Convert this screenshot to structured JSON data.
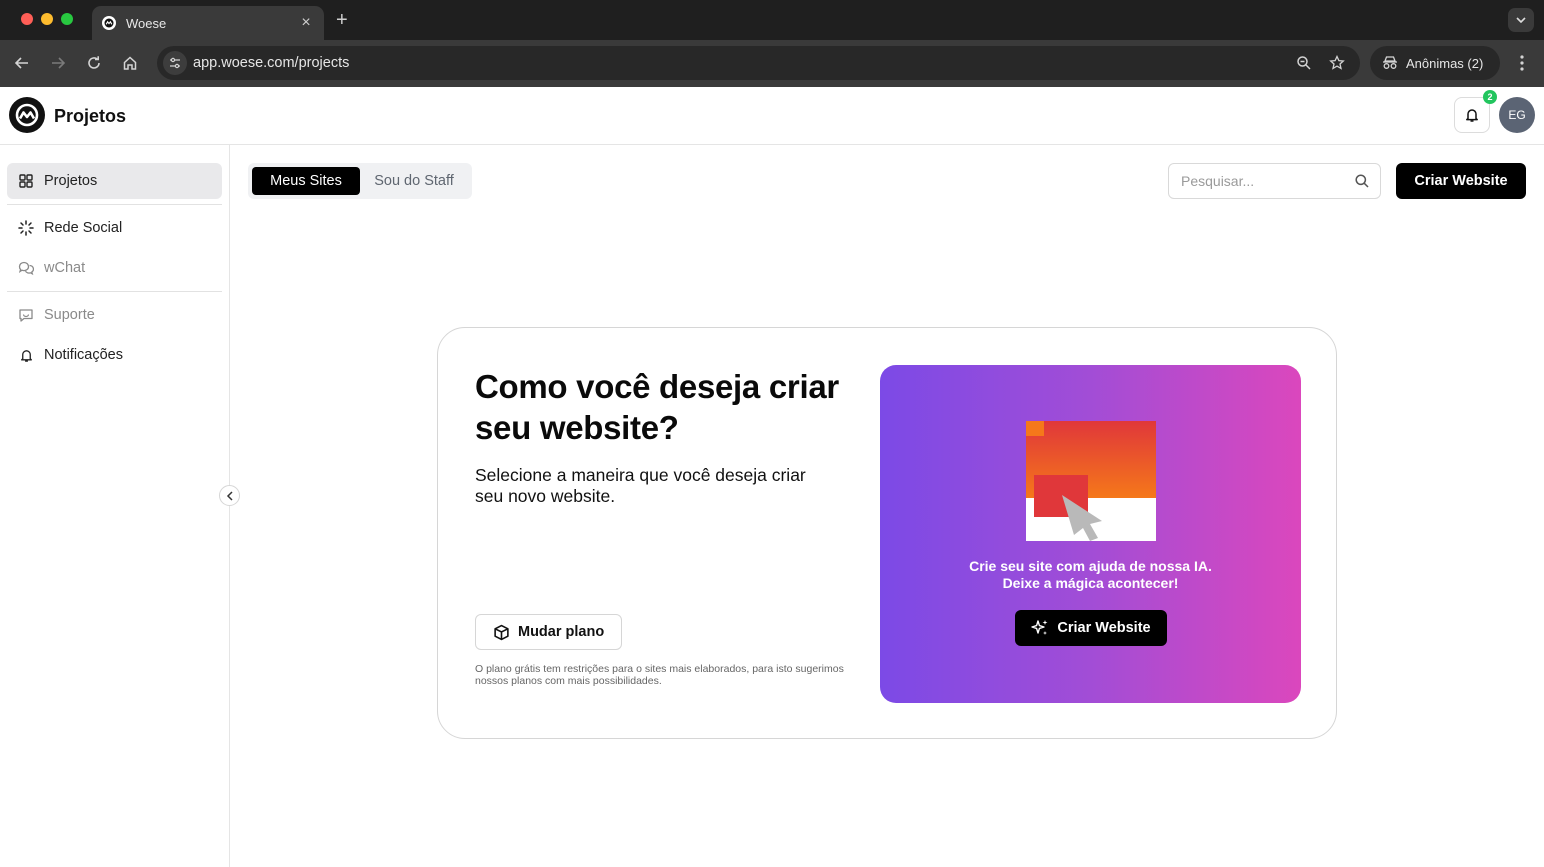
{
  "browser": {
    "tab_title": "Woese",
    "url": "app.woese.com/projects",
    "profile_label": "Anônimas (2)"
  },
  "header": {
    "title": "Projetos",
    "notification_count": "2",
    "avatar_initials": "EG"
  },
  "sidebar": {
    "items": [
      {
        "label": "Projetos",
        "icon": "grid-icon",
        "active": true
      },
      {
        "label": "Rede Social",
        "icon": "sparkle-dots-icon"
      },
      {
        "label": "wChat",
        "icon": "chat-bubbles-icon"
      },
      {
        "label": "Suporte",
        "icon": "support-message-icon"
      },
      {
        "label": "Notificações",
        "icon": "bell-icon"
      }
    ]
  },
  "main": {
    "tabs": [
      {
        "label": "Meus Sites",
        "active": true
      },
      {
        "label": "Sou do Staff",
        "active": false
      }
    ],
    "search_placeholder": "Pesquisar...",
    "create_button": "Criar Website"
  },
  "card": {
    "title": "Como você deseja criar seu website?",
    "subtitle": "Selecione a maneira que você deseja criar seu novo website.",
    "plan_button": "Mudar plano",
    "plan_note": "O plano grátis tem restrições para o sites mais elaborados, para isto sugerimos nossos planos com mais possibilidades.",
    "promo_line1": "Crie seu site com ajuda de nossa IA.",
    "promo_line2": "Deixe a mágica acontecer!",
    "promo_button": "Criar Website"
  },
  "colors": {
    "accent": "#000000",
    "badge": "#22c55e",
    "gradient_start": "#7c4ae6",
    "gradient_end": "#db47bd"
  }
}
